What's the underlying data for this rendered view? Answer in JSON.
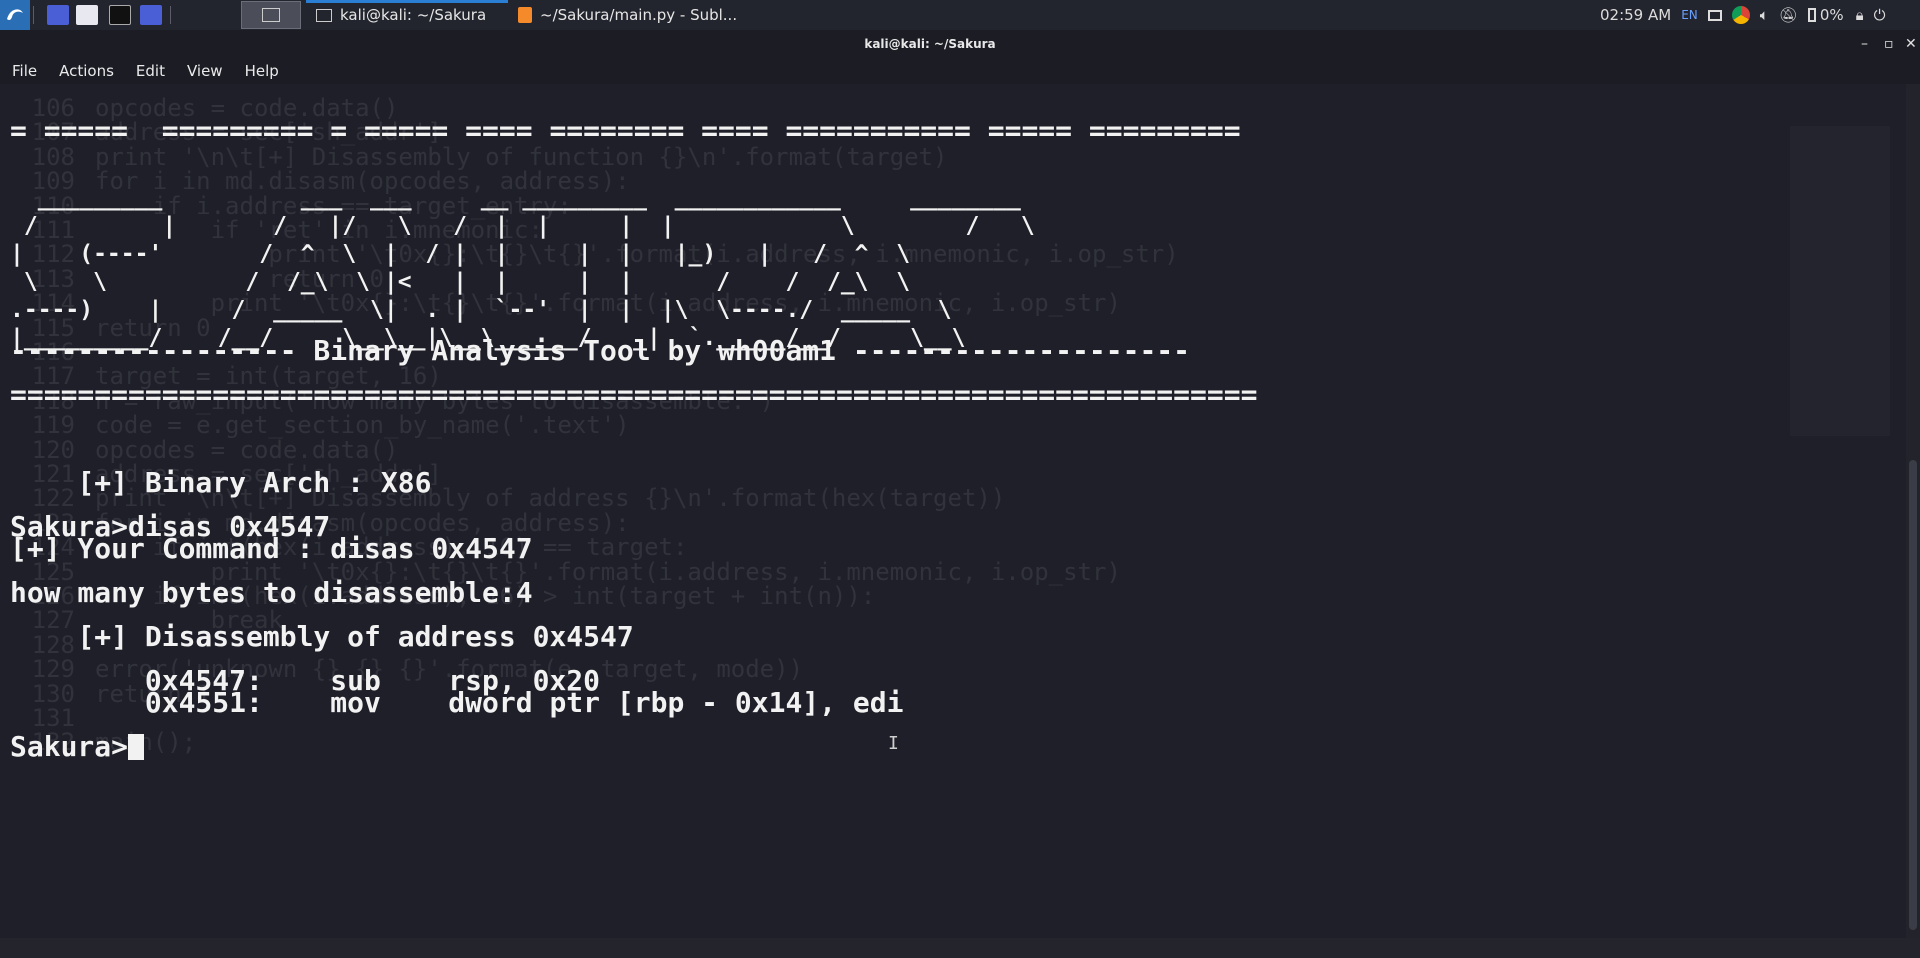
{
  "taskbar": {
    "workspace_icon": "terminal-icon",
    "tasks": [
      {
        "label": "kali@kali: ~/Sakura",
        "icon": "terminal-icon"
      },
      {
        "label": "~/Sakura/main.py - Subl...",
        "icon": "sublime-icon"
      }
    ],
    "clock": "02:59 AM",
    "lang": "EN",
    "battery": "0%"
  },
  "window": {
    "title": "kali@kali: ~/Sakura",
    "menu": [
      "File",
      "Actions",
      "Edit",
      "View",
      "Help"
    ]
  },
  "terminal": {
    "divider_top": "= =====  ========= = ===== ==== ======== ==== =========== ===== =========",
    "banner": "  _________          ___  ___     __ _________  ____________     ________\n /         |       /   |/   \\   /  |  |     |  |            \\        /   \\\n|    (----'       /  ^  \\  |  / |  |     |  |   |_)   |   /  ^  \\\n \\    \\          /  /_\\  \\ |<   |  |     |  |      /    /  /_\\  \\\n.----)    |     /  _____  \\|  . |  `--'  |  |  |\\  \\----./  _____  \\\n|_________/    /__/     \\__\\__|\\__\\______/   _|  `._____/__/     \\__\\",
    "subtitle": "----------------- Binary Analysis Tool by wh00am1 --------------------",
    "divider_eq": "==========================================================================",
    "arch": "    [+] Binary Arch : X86",
    "prompt1": "Sakura>disas 0x4547",
    "cmd_echo": "[+] Your Command : disas 0x4547",
    "bytes_prompt": "how many bytes to disassemble:4",
    "disasm_header": "    [+] Disassembly of address 0x4547",
    "disasm": [
      "        0x4547:    sub    rsp, 0x20",
      "        0x4551:    mov    dword ptr [rbp - 0x14], edi"
    ],
    "prompt2": "Sakura>"
  },
  "ghost_code": [
    {
      "n": "106",
      "t": "opcodes = code.data()"
    },
    {
      "n": "107",
      "t": "address = sec['sh_addr']"
    },
    {
      "n": "108",
      "t": "print '\\n\\t[+] Disassembly of function {}\\n'.format(target)"
    },
    {
      "n": "109",
      "t": "for i in md.disasm(opcodes, address):"
    },
    {
      "n": "110",
      "t": "    if i.address == target_entry:"
    },
    {
      "n": "111",
      "t": "        if 'ret' in i.mnemonic:"
    },
    {
      "n": "112",
      "t": "            print '\\t0x{}:\\t{}\\t{}'.format(i.address, i.mnemonic, i.op_str)"
    },
    {
      "n": "113",
      "t": "            return 0"
    },
    {
      "n": "114",
      "t": "        print '\\t0x{}:\\t{}\\t{}'.format(i.address, i.mnemonic, i.op_str)"
    },
    {
      "n": "115",
      "t": "return 0"
    },
    {
      "n": "116",
      "t": ""
    },
    {
      "n": "117",
      "t": "target = int(target, 16)"
    },
    {
      "n": "118",
      "t": "n = raw_input('how many bytes to disassemble:')"
    },
    {
      "n": "119",
      "t": "code = e.get_section_by_name('.text')"
    },
    {
      "n": "120",
      "t": "opcodes = code.data()"
    },
    {
      "n": "121",
      "t": "address = sec['sh_addr']"
    },
    {
      "n": "122",
      "t": "print '\\n\\t[+] Disassembly of address {}\\n'.format(hex(target))"
    },
    {
      "n": "123",
      "t": "for i in md.disasm(opcodes, address):"
    },
    {
      "n": "124",
      "t": "    if int(hex(i.address), 16) == target:"
    },
    {
      "n": "125",
      "t": "        print '\\t0x{}:\\t{}\\t{}'.format(i.address, i.mnemonic, i.op_str)"
    },
    {
      "n": "126",
      "t": "    if int(hex(i.address), 16) > int(target + int(n)):"
    },
    {
      "n": "127",
      "t": "        break"
    },
    {
      "n": "128",
      "t": ""
    },
    {
      "n": "129",
      "t": "error('unknown {} {} {}'.format(e, target, mode))"
    },
    {
      "n": "130",
      "t": "return 1"
    },
    {
      "n": "131",
      "t": ""
    },
    {
      "n": "132",
      "t": "main();"
    }
  ],
  "colors": {
    "background": "#1e1f28",
    "text": "#f2f2f2",
    "panel": "#23252e",
    "accent": "#2a7fd4"
  }
}
